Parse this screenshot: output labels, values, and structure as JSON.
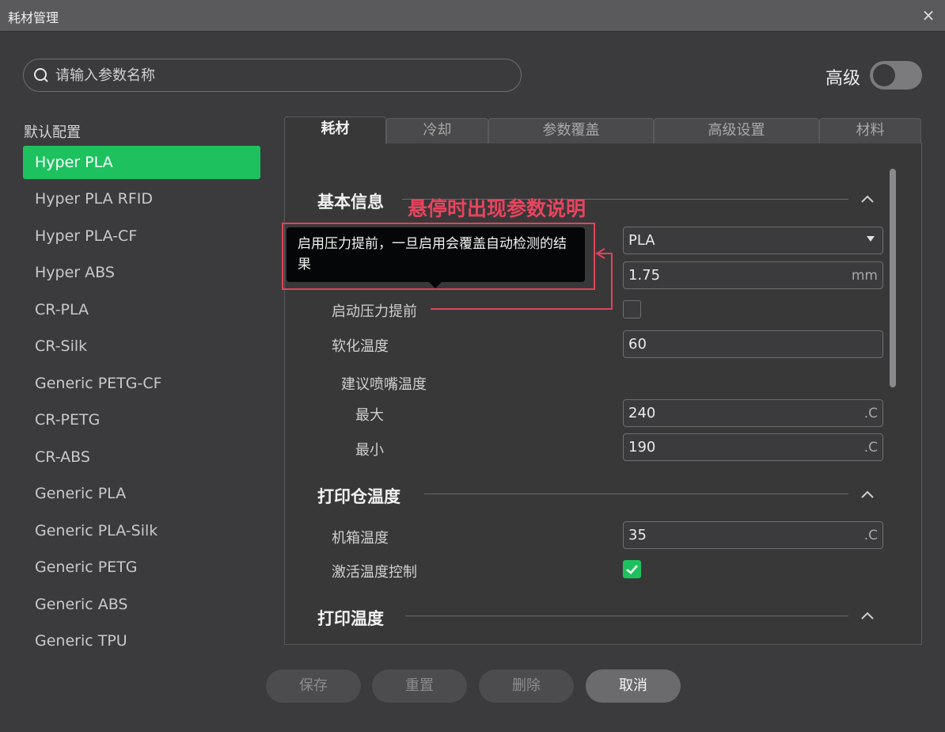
{
  "window": {
    "title": "耗材管理",
    "close_icon": "×"
  },
  "search": {
    "placeholder": "请输入参数名称"
  },
  "advanced": {
    "label": "高级",
    "enabled": false
  },
  "config": {
    "label": "默认配置",
    "presets": [
      "Hyper PLA",
      "Hyper PLA RFID",
      "Hyper PLA-CF",
      "Hyper ABS",
      "CR-PLA",
      "CR-Silk",
      "Generic PETG-CF",
      "CR-PETG",
      "CR-ABS",
      "Generic PLA",
      "Generic PLA-Silk",
      "Generic PETG",
      "Generic ABS",
      "Generic TPU"
    ],
    "selected": "Hyper PLA"
  },
  "tabs": [
    "耗材",
    "冷却",
    "参数覆盖",
    "高级设置",
    "材料"
  ],
  "active_tab": "耗材",
  "basic": {
    "title": "基本信息",
    "filament_type": "PLA",
    "diameter": {
      "value": "1.75",
      "unit": "mm"
    },
    "pressure_advance": {
      "label": "启动压力提前",
      "checked": false
    },
    "softening": {
      "label": "软化温度",
      "value": "60"
    },
    "nozzle_temp": {
      "label": "建议喷嘴温度"
    },
    "max": {
      "label": "最大",
      "value": "240",
      "unit": ".C"
    },
    "min": {
      "label": "最小",
      "value": "190",
      "unit": ".C"
    }
  },
  "chamber": {
    "title": "打印仓温度",
    "chamber_temp": {
      "label": "机箱温度",
      "value": "35",
      "unit": ".C"
    },
    "activate": {
      "label": "激活温度控制",
      "checked": true
    }
  },
  "print_temp": {
    "title": "打印温度"
  },
  "tooltip": {
    "text": "启用压力提前，一旦启用会覆盖自动检测的结果"
  },
  "annotation": {
    "text": "悬停时出现参数说明",
    "color": "#e8445e"
  },
  "footer": {
    "save": "保存",
    "reset": "重置",
    "delete": "删除",
    "cancel": "取消"
  },
  "colors": {
    "accent": "#1dc25f",
    "annotation": "#e0445c"
  }
}
